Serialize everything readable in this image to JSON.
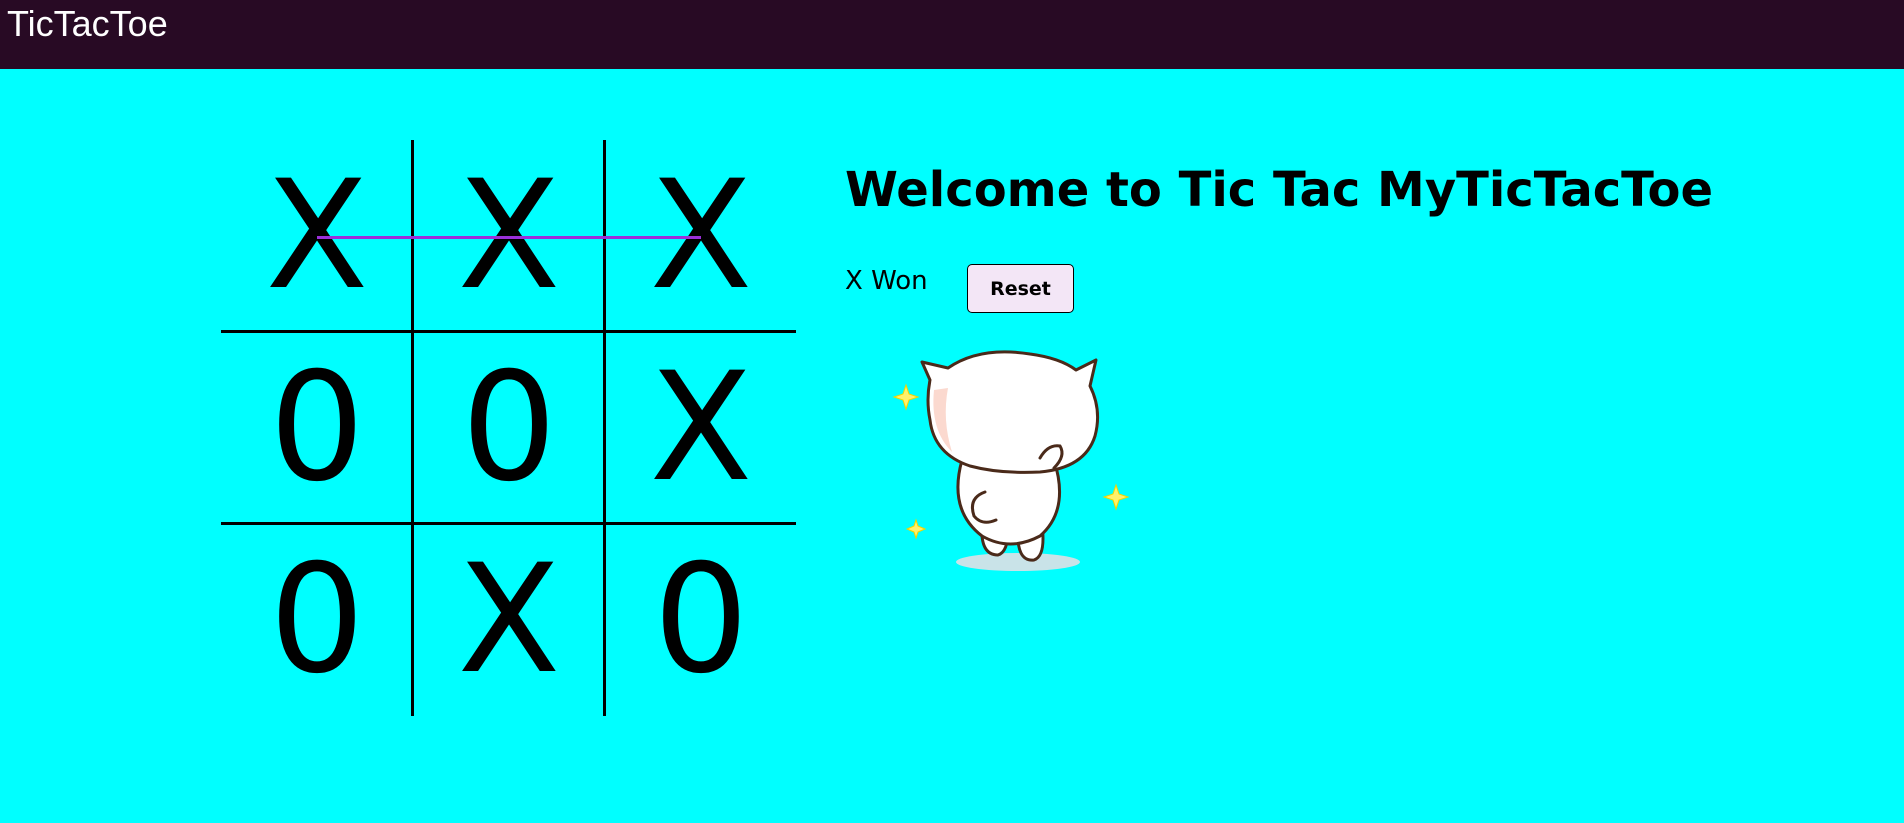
{
  "app": {
    "title": "TicTacToe"
  },
  "game": {
    "heading": "Welcome to Tic Tac MyTicTacToe",
    "status": "X Won",
    "reset_label": "Reset",
    "board": [
      [
        "X",
        "X",
        "X"
      ],
      [
        "0",
        "0",
        "X"
      ],
      [
        "0",
        "X",
        "0"
      ]
    ],
    "winning_row": 0
  },
  "colors": {
    "header_bg": "#280a24",
    "page_bg": "#00ffff",
    "win_line": "#9b30d9",
    "button_bg": "#f3e6f6"
  },
  "illustration": {
    "icon": "celebrating-cat-icon"
  }
}
